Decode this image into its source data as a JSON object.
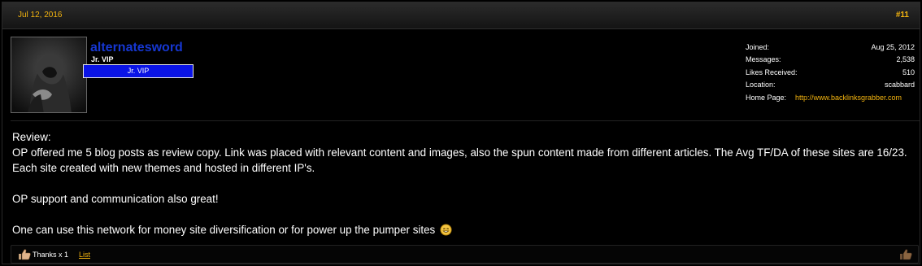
{
  "post": {
    "date": "Jul 12, 2016",
    "number": "#11"
  },
  "user": {
    "name": "alternatesword",
    "title": "Jr. VIP",
    "banner": "Jr. VIP"
  },
  "stats": [
    {
      "label": "Joined:",
      "value": "Aug 25, 2012"
    },
    {
      "label": "Messages:",
      "value": "2,538"
    },
    {
      "label": "Likes Received:",
      "value": "510"
    },
    {
      "label": "Location:",
      "value": "scabbard"
    },
    {
      "label": "Home Page:",
      "value": "http://www.backlinksgrabber.com"
    }
  ],
  "message": {
    "line1": "Review:",
    "line2": "OP offered me 5 blog posts as review copy. Link was placed with relevant content and images, also the spun content made from different articles. The Avg TF/DA of these sites are 16/23. Each site created with new themes and hosted in different IP's.",
    "line3": "OP support and communication also great!",
    "line4": "One can use this network for money site diversification or for power up the pumper sites"
  },
  "footer": {
    "thanks": "Thanks x 1",
    "list_label": "List"
  },
  "colors": {
    "accent": "#f5b50f",
    "username": "#1637d2",
    "banner": "#0a14e6"
  }
}
